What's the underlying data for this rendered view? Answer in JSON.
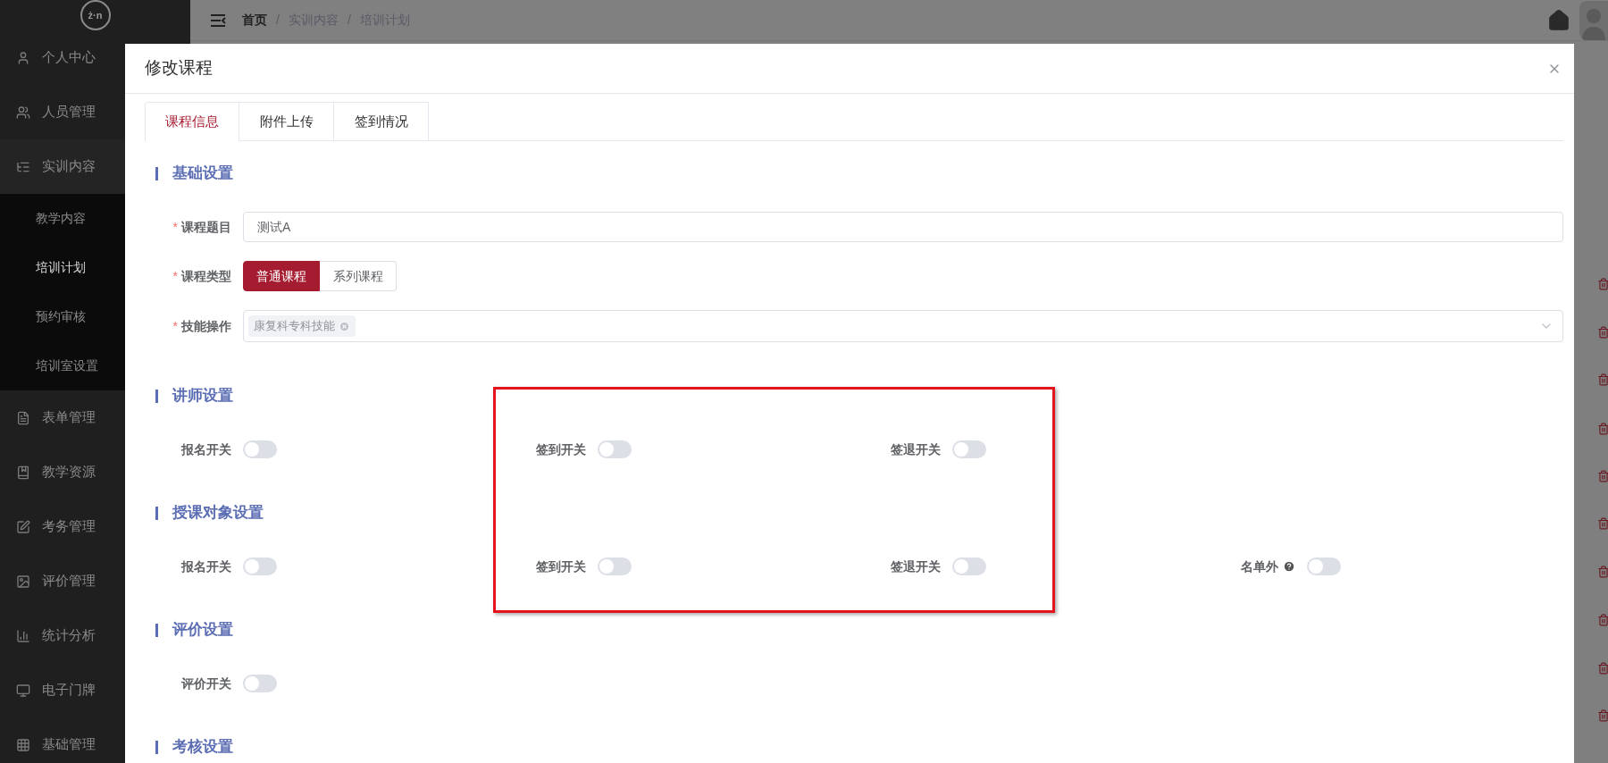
{
  "sidebar": {
    "logo": "ż·n",
    "items": [
      {
        "label": "个人中心",
        "selected": false,
        "expanded": false
      },
      {
        "label": "人员管理",
        "selected": false,
        "expanded": false
      },
      {
        "label": "实训内容",
        "selected": false,
        "expanded": true,
        "children": [
          {
            "label": "教学内容",
            "selected": false
          },
          {
            "label": "培训计划",
            "selected": true
          },
          {
            "label": "预约审核",
            "selected": false
          },
          {
            "label": "培训室设置",
            "selected": false
          }
        ]
      },
      {
        "label": "表单管理",
        "selected": false,
        "expanded": false
      },
      {
        "label": "教学资源",
        "selected": false,
        "expanded": false
      },
      {
        "label": "考务管理",
        "selected": false,
        "expanded": false
      },
      {
        "label": "评价管理",
        "selected": false,
        "expanded": false
      },
      {
        "label": "统计分析",
        "selected": false,
        "expanded": false
      },
      {
        "label": "电子门牌",
        "selected": false,
        "expanded": false
      },
      {
        "label": "基础管理",
        "selected": false,
        "expanded": false
      }
    ]
  },
  "breadcrumb": {
    "separator": "/",
    "items": [
      "首页",
      "实训内容",
      "培训计划"
    ]
  },
  "dialog": {
    "title": "修改课程",
    "tabs": [
      {
        "label": "课程信息",
        "selected": true
      },
      {
        "label": "附件上传",
        "selected": false
      },
      {
        "label": "签到情况",
        "selected": false
      }
    ],
    "sections": [
      {
        "title": "基础设置",
        "kind": "form",
        "fields": [
          {
            "label": "课程题目",
            "required_mark": "*",
            "kind": "text",
            "value": "测试A"
          },
          {
            "label": "课程类型",
            "required_mark": "*",
            "kind": "segmented",
            "options": [
              {
                "label": "普通课程",
                "selected": true
              },
              {
                "label": "系列课程",
                "selected": false
              }
            ]
          },
          {
            "label": "技能操作",
            "required_mark": "*",
            "kind": "tags",
            "tags": [
              "康复科专科技能"
            ]
          }
        ]
      },
      {
        "title": "讲师设置",
        "kind": "switches",
        "switches": [
          {
            "label": "报名开关",
            "on": false
          },
          {
            "label": "签到开关",
            "on": false
          },
          {
            "label": "签退开关",
            "on": false
          }
        ]
      },
      {
        "title": "授课对象设置",
        "kind": "switches",
        "switches": [
          {
            "label": "报名开关",
            "on": false
          },
          {
            "label": "签到开关",
            "on": false
          },
          {
            "label": "签退开关",
            "on": false
          },
          {
            "label": "名单外",
            "on": false,
            "help": true
          }
        ]
      },
      {
        "title": "评价设置",
        "kind": "switches",
        "switches": [
          {
            "label": "评价开关",
            "on": false
          }
        ]
      },
      {
        "title": "考核设置",
        "kind": "switches"
      }
    ]
  }
}
